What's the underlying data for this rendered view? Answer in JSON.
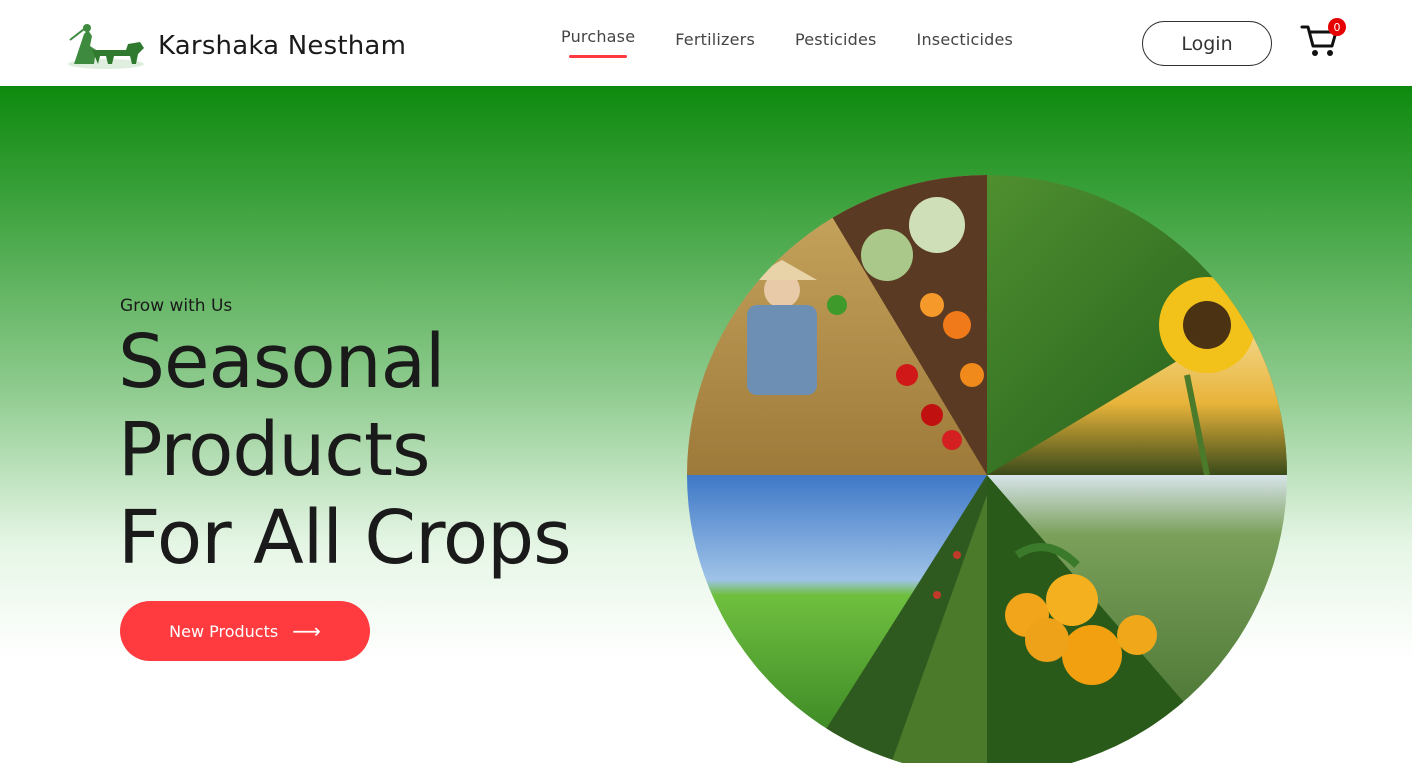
{
  "brand": {
    "name": "Karshaka Nestham",
    "logo_icon": "farmer-plough-logo-icon"
  },
  "nav": {
    "items": [
      {
        "label": "Purchase",
        "active": true
      },
      {
        "label": "Fertilizers",
        "active": false
      },
      {
        "label": "Pesticides",
        "active": false
      },
      {
        "label": "Insecticides",
        "active": false
      }
    ]
  },
  "header": {
    "login_label": "Login",
    "cart_count": "0",
    "cart_icon": "shopping-cart-icon"
  },
  "hero": {
    "tagline": "Grow with Us",
    "headline": [
      "Seasonal",
      "Products",
      "For All Crops"
    ],
    "cta_label": "New Products",
    "cta_icon": "arrow-right-icon"
  },
  "colors": {
    "accent": "#ff3b3f",
    "brand_green": "#0e8a0e",
    "badge": "#e60000"
  },
  "collage": {
    "images": [
      "farmer-harvesting-image",
      "vegetable-market-image",
      "rice-field-image",
      "sunflower-image",
      "green-paddy-field-image",
      "crop-row-image",
      "orange-tree-image",
      "wheat-field-image"
    ]
  }
}
